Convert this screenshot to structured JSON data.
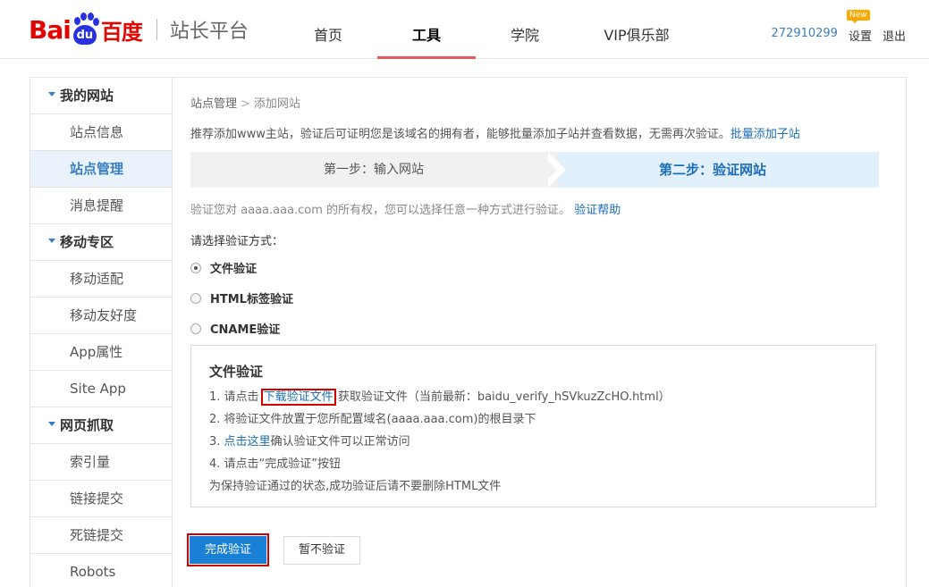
{
  "header": {
    "logo_bai": "Bai",
    "logo_du": "du",
    "logo_cn": "百度",
    "logo_sub": "站长平台",
    "nav": [
      "首页",
      "工具",
      "学院",
      "VIP俱乐部"
    ],
    "active_nav": "工具",
    "user_id": "272910299",
    "new_badge": "New",
    "settings": "设置",
    "logout": "退出"
  },
  "sidebar": {
    "groups": [
      {
        "title": "我的网站",
        "items": [
          "站点信息",
          "站点管理",
          "消息提醒"
        ]
      },
      {
        "title": "移动专区",
        "items": [
          "移动适配",
          "移动友好度",
          "App属性",
          "Site App"
        ]
      },
      {
        "title": "网页抓取",
        "items": [
          "索引量",
          "链接提交",
          "死链提交",
          "Robots"
        ]
      }
    ],
    "active_item": "站点管理"
  },
  "main": {
    "breadcrumb": {
      "parent": "站点管理",
      "sep": ">",
      "current": "添加网站"
    },
    "intro": "推荐添加www主站，验证后可证明您是该域名的拥有者，能够批量添加子站并查看数据，无需再次验证。",
    "intro_link": "批量添加子站",
    "step1": "第一步：输入网站",
    "step2": "第二步：验证网站",
    "desc": "验证您对 aaaa.aaa.com 的所有权，您可以选择任意一种方式进行验证。",
    "desc_link": "验证帮助",
    "choose_label": "请选择验证方式：",
    "methods": [
      "文件验证",
      "HTML标签验证",
      "CNAME验证"
    ],
    "selected_method": "文件验证",
    "box": {
      "title": "文件验证",
      "line1_pre": "1. 请点击 ",
      "line1_link": "下载验证文件",
      "line1_post": " 获取验证文件（当前最新：baidu_verify_hSVkuzZcHO.html）",
      "line2": "2. 将验证文件放置于您所配置域名(aaaa.aaa.com)的根目录下",
      "line3_pre": "3. ",
      "line3_link": "点击这里",
      "line3_post": "确认验证文件可以正常访问",
      "line4": "4. 请点击“完成验证”按钮",
      "line5": "为保持验证通过的状态,成功验证后请不要删除HTML文件"
    },
    "btn_done": "完成验证",
    "btn_skip": "暂不验证"
  },
  "colors": {
    "brand_red": "#e10602",
    "brand_blue": "#2932e1",
    "link": "#1d6eb8",
    "primary_button": "#1a80d6"
  }
}
